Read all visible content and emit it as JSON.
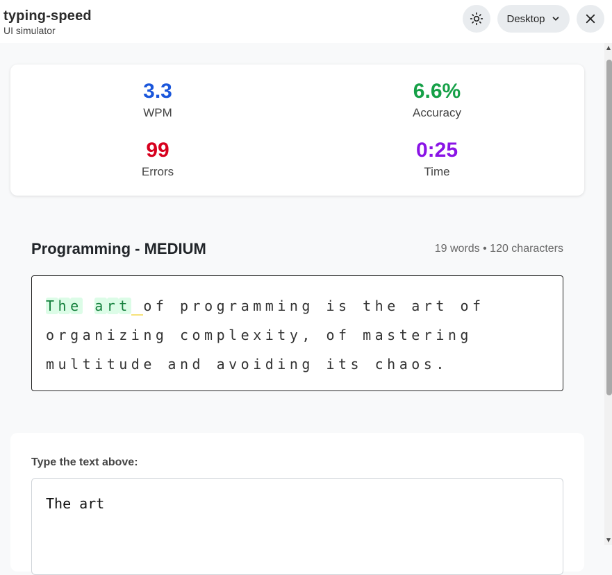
{
  "app": {
    "name": "typing-speed",
    "subtitle": "UI simulator"
  },
  "toolbar": {
    "device_label": "Desktop",
    "theme_icon": "sun-icon",
    "device_icon": "chevron-down-icon",
    "close_icon": "close-icon"
  },
  "stats": {
    "wpm": {
      "value": "3.3",
      "label": "WPM",
      "color": "#1a56db"
    },
    "accuracy": {
      "value": "6.6%",
      "label": "Accuracy",
      "color": "#15a047"
    },
    "errors": {
      "value": "99",
      "label": "Errors",
      "color": "#d7001e"
    },
    "time": {
      "value": "0:25",
      "label": "Time",
      "color": "#8a14e6"
    }
  },
  "passage": {
    "title": "Programming - MEDIUM",
    "meta": "19 words • 120 characters",
    "typed_correct": [
      "T",
      "h",
      "e",
      " ",
      "a",
      "r",
      "t"
    ],
    "current": " ",
    "remaining": "of programming is the art of organizing complexity, of mastering multitude and avoiding its chaos."
  },
  "typing": {
    "label": "Type the text above:",
    "value": "The art"
  }
}
